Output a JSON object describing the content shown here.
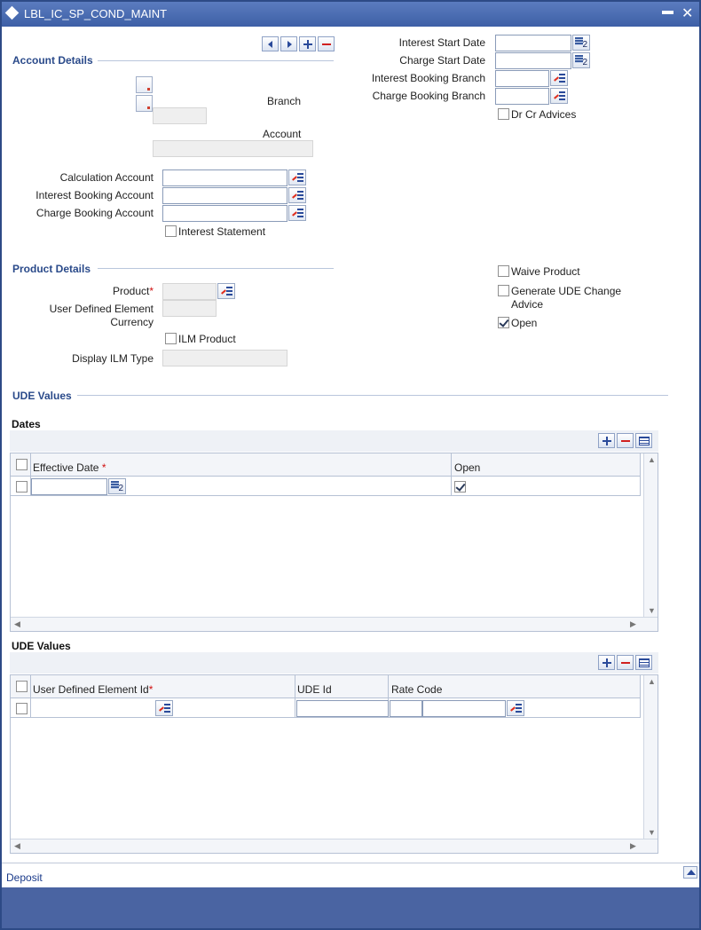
{
  "window": {
    "title": "LBL_IC_SP_COND_MAINT",
    "minimize_label": "▬",
    "close_label": "✕"
  },
  "account_details": {
    "section_title": "Account Details",
    "branch_label": "Branch",
    "account_label": "Account",
    "calculation_account_label": "Calculation Account",
    "interest_booking_account_label": "Interest Booking Account",
    "charge_booking_account_label": "Charge Booking Account",
    "interest_statement_label": "Interest Statement",
    "interest_statement_checked": false
  },
  "right_panel": {
    "interest_start_date_label": "Interest Start Date",
    "charge_start_date_label": "Charge Start Date",
    "interest_booking_branch_label": "Interest Booking Branch",
    "charge_booking_branch_label": "Charge Booking Branch",
    "dr_cr_advices_label": "Dr Cr Advices",
    "dr_cr_advices_checked": false
  },
  "product_details": {
    "section_title": "Product Details",
    "product_label": "Product",
    "required_mark": "*",
    "ude_currency_label_line1": "User Defined Element",
    "ude_currency_label_line2": "Currency",
    "ilm_product_label": "ILM Product",
    "display_ilm_type_label": "Display ILM Type",
    "waive_product_label": "Waive Product",
    "generate_ude_label_line1": "Generate UDE Change",
    "generate_ude_label_line2": "Advice",
    "open_label": "Open",
    "waive_checked": false,
    "generate_ude_checked": false,
    "open_checked": true
  },
  "ude_values": {
    "section_title": "UDE Values",
    "dates": {
      "title": "Dates",
      "columns": [
        "Effective Date",
        "Open"
      ],
      "rows": [
        {
          "effective_date": "",
          "open": true
        }
      ]
    },
    "values": {
      "title": "UDE Values",
      "columns": [
        "User Defined Element Id",
        "UDE Id",
        "Rate Code"
      ],
      "rows": [
        {
          "ude_id": "",
          "rate_code": ""
        }
      ]
    }
  },
  "calendar_badge": "2",
  "footer": {
    "link": "Deposit"
  },
  "colors": {
    "title_bar": "#4a6cb0",
    "section": "#2a4a8a",
    "bottom_band": "#4a64a2",
    "required": "#d01010"
  }
}
